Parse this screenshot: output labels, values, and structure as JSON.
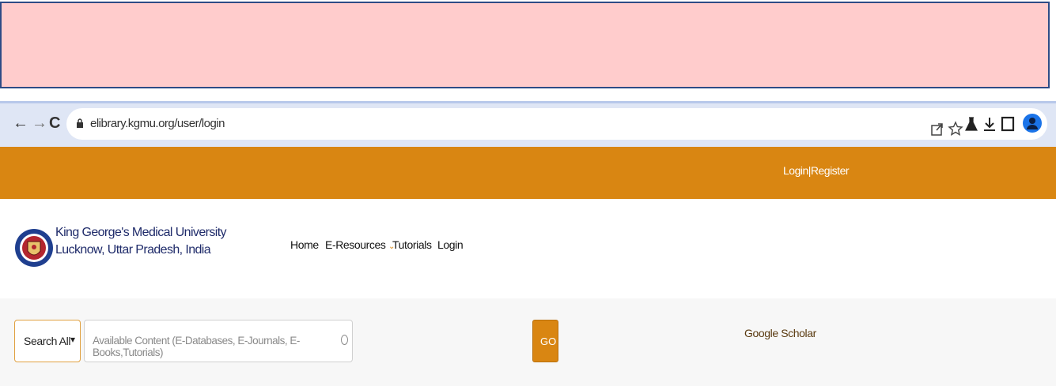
{
  "browser": {
    "url": "elibrary.kgmu.org/user/login",
    "back_icon": "back-arrow-icon",
    "forward_icon": "forward-arrow-icon",
    "reload_icon": "reload-icon",
    "toolbar_icons": [
      "share-icon",
      "star-icon",
      "lab-flask-icon",
      "download-icon",
      "sidepanel-icon",
      "profile-icon"
    ]
  },
  "topbar": {
    "login_register": "Login|Register"
  },
  "header": {
    "university_line1": "King George's Medical University",
    "university_line2": "Lucknow, Uttar Pradesh, India",
    "menu": {
      "home": "Home",
      "eresources": "E-Resources",
      "tutorials": "Tutorials",
      "login": "Login"
    }
  },
  "search": {
    "scope_selected": "Search All",
    "placeholder": "Available Content (E-Databases, E-Journals, E-Books,Tutorials)",
    "go_label": "GO",
    "scholar_link": "Google Scholar"
  },
  "colors": {
    "banner_pink": "#ffcccc",
    "banner_border": "#2e4b86",
    "browser_bar": "#dfe6f5",
    "accent_orange": "#d98612",
    "university_text": "#1f2b6a"
  }
}
